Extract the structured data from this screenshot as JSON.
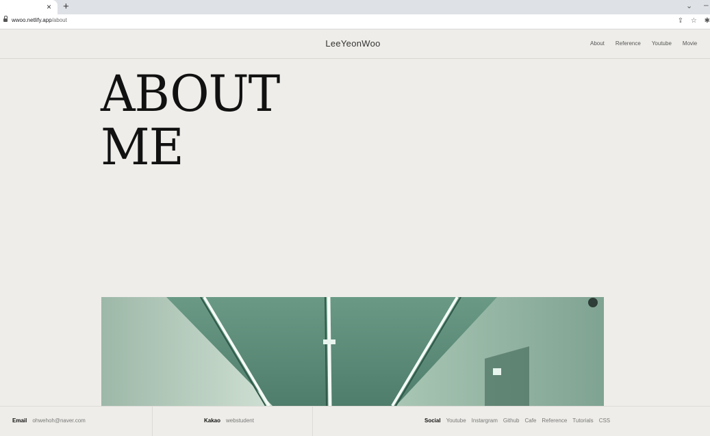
{
  "browser": {
    "new_tab": "+",
    "close": "×",
    "url_host": "wwoo.netlify.app",
    "url_path": "/about"
  },
  "header": {
    "logo": "LeeYeonWoo",
    "nav": [
      "About",
      "Reference",
      "Youtube",
      "Movie"
    ]
  },
  "hero": {
    "line1": "ABOUT",
    "line2": "ME"
  },
  "footer": {
    "email_label": "Email",
    "email_value": "ohwehoh@naver.com",
    "kakao_label": "Kakao",
    "kakao_value": "webstudent",
    "social_label": "Social",
    "social_links": [
      "Youtube",
      "Instargram",
      "Github",
      "Cafe",
      "Reference",
      "Tutorials",
      "CSS"
    ]
  },
  "colors": {
    "page_bg": "#eeede9",
    "photo_teal": "#5f8a79"
  },
  "icons": [
    "lock-icon",
    "share-icon",
    "star-icon",
    "extensions-icon",
    "chevron-down-icon",
    "minimize-icon"
  ]
}
